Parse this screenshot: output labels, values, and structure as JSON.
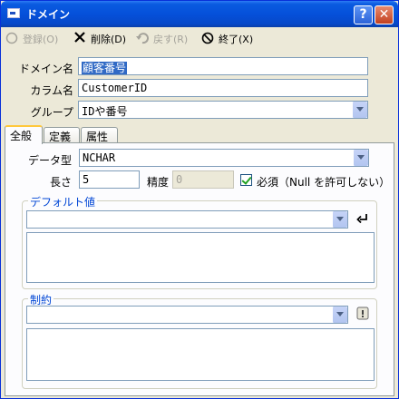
{
  "window": {
    "title": "ドメイン",
    "help_label": "?",
    "close_label": "✕"
  },
  "toolbar": {
    "register_label": "登録(O)",
    "delete_label": "削除(D)",
    "revert_label": "戻す(R)",
    "exit_label": "終了(X)"
  },
  "form": {
    "domain_name_label": "ドメイン名",
    "domain_name_value": "顧客番号",
    "column_name_label": "カラム名",
    "column_name_value": "CustomerID",
    "group_label": "グループ",
    "group_value": "IDや番号"
  },
  "tabs": [
    {
      "label": "全般",
      "active": true
    },
    {
      "label": "定義",
      "active": false
    },
    {
      "label": "属性",
      "active": false
    }
  ],
  "general": {
    "data_type_label": "データ型",
    "data_type_value": "NCHAR",
    "length_label": "長さ",
    "length_value": "5",
    "precision_label": "精度",
    "precision_value": "0",
    "required_label": "必須（Null を許可しない）",
    "required_checked": true,
    "default_group_label": "デフォルト値",
    "constraint_group_label": "制約"
  }
}
